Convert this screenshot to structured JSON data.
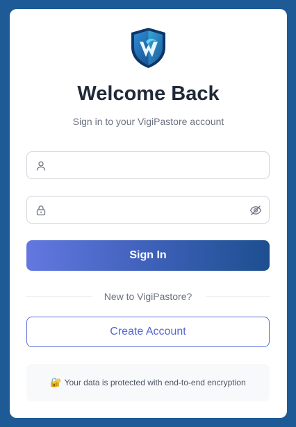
{
  "brand": {
    "logo_icon": "shield-v-logo-icon",
    "colors": {
      "background": "#1d5a96",
      "primary_start": "#6378e0",
      "primary_end": "#1d4f8f",
      "accent": "#5566d4"
    }
  },
  "header": {
    "title": "Welcome Back",
    "subtitle": "Sign in to your VigiPastore account"
  },
  "form": {
    "username": {
      "value": "",
      "placeholder": "",
      "icon": "user-icon"
    },
    "password": {
      "value": "",
      "placeholder": "",
      "icon": "lock-icon",
      "toggle_icon": "eye-slash-icon"
    },
    "submit_label": "Sign In"
  },
  "divider": {
    "text": "New to VigiPastore?"
  },
  "create_account": {
    "label": "Create Account"
  },
  "security_notice": {
    "icon": "🔐",
    "text": "Your data is protected with end-to-end encryption"
  }
}
